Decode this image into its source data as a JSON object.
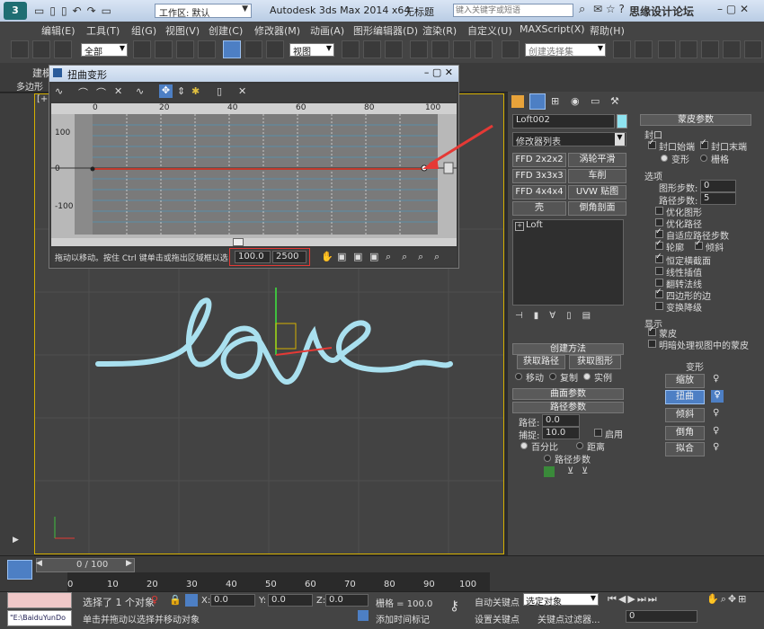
{
  "title": {
    "workspace": "工作区: 默认",
    "app_title": "Autodesk 3ds Max  2014 x64",
    "file_name": "无标题",
    "search_placeholder": "键入关键字或短语",
    "watermark": "思缘设计论坛"
  },
  "menu": [
    "编辑(E)",
    "工具(T)",
    "组(G)",
    "视图(V)",
    "创建(C)",
    "修改器(M)",
    "动画(A)",
    "图形编辑器(D)",
    "渲染(R)",
    "自定义(U)",
    "MAXScript(X)",
    "帮助(H)"
  ],
  "toolbar": {
    "selection_filter": "全部",
    "ref_coord": "视图",
    "named_sel": "创建选择集"
  },
  "ribbon": {
    "tab": "建模",
    "sub": "多边形"
  },
  "dialog": {
    "title": "扭曲变形",
    "ruler_labels": [
      "0",
      "20",
      "40",
      "60",
      "80",
      "100"
    ],
    "y_labels": [
      "100",
      "0",
      "-100"
    ],
    "status_text": "拖动以移动。按住 Ctrl 键单击或拖出区域框以选",
    "value1": "100.0",
    "value2": "2500"
  },
  "viewport": {
    "label": "[+]",
    "shape_text": "love"
  },
  "cmd": {
    "object_name": "Loft002",
    "modifier_list": "修改器列表",
    "modifier_buttons": [
      "FFD 2x2x2",
      "涡轮平滑",
      "FFD 3x3x3",
      "车削",
      "FFD 4x4x4",
      "UVW 贴图",
      "壳",
      "倒角剖面"
    ],
    "stack_item": "Loft",
    "creation": {
      "header": "创建方法",
      "get_path": "获取路径",
      "get_shape": "获取图形",
      "move": "移动",
      "copy": "复制",
      "instance": "实例"
    },
    "surface_header": "曲面参数",
    "path": {
      "header": "路径参数",
      "path_label": "路径:",
      "path_value": "0.0",
      "snap_label": "捕捉:",
      "snap_value": "10.0",
      "enable": "启用",
      "percent": "百分比",
      "distance": "距离",
      "steps": "路径步数"
    }
  },
  "skin": {
    "header": "蒙皮参数",
    "capping": "封口",
    "cap_start": "封口始端",
    "cap_end": "封口末端",
    "morph": "变形",
    "grid": "栅格",
    "options": "选项",
    "shape_steps_label": "图形步数:",
    "shape_steps": "0",
    "path_steps_label": "路径步数:",
    "path_steps": "5",
    "opt_checks": [
      {
        "label": "优化图形",
        "on": false
      },
      {
        "label": "优化路径",
        "on": false
      },
      {
        "label": "自适应路径步数",
        "on": true
      },
      {
        "label": "轮廓",
        "on": true
      },
      {
        "label": "倾斜",
        "on": true
      },
      {
        "label": "恒定横截面",
        "on": true
      },
      {
        "label": "线性插值",
        "on": false
      },
      {
        "label": "翻转法线",
        "on": false
      },
      {
        "label": "四边形的边",
        "on": true
      },
      {
        "label": "变换降级",
        "on": false
      }
    ],
    "display": "显示",
    "skin_check": "蒙皮",
    "skin_shaded": "明暗处理视图中的蒙皮"
  },
  "deform": {
    "header": "变形",
    "buttons": [
      "缩放",
      "扭曲",
      "倾斜",
      "倒角",
      "拟合"
    ],
    "active": "扭曲"
  },
  "timeline": {
    "counter": "0 / 100",
    "ticks": [
      "0",
      "10",
      "20",
      "30",
      "40",
      "50",
      "60",
      "70",
      "80",
      "90",
      "100"
    ]
  },
  "status": {
    "selected": "选择了 1 个对象",
    "hint": "单击并拖动以选择并移动对象",
    "x": "0.0",
    "y": "0.0",
    "z": "0.0",
    "grid": "栅格 = 100.0",
    "add_tag": "添加时间标记",
    "auto_key": "自动关键点",
    "set_key": "设置关键点",
    "sel_obj": "选定对象",
    "key_filter": "关键点过滤器...",
    "frame": "0",
    "script": "\"E:\\BaiduYunDo"
  },
  "colors": {
    "accent": "#4d7fc4",
    "highlight_border": "#d5b000",
    "curve": "#c0392b",
    "arrow": "#e53935"
  }
}
